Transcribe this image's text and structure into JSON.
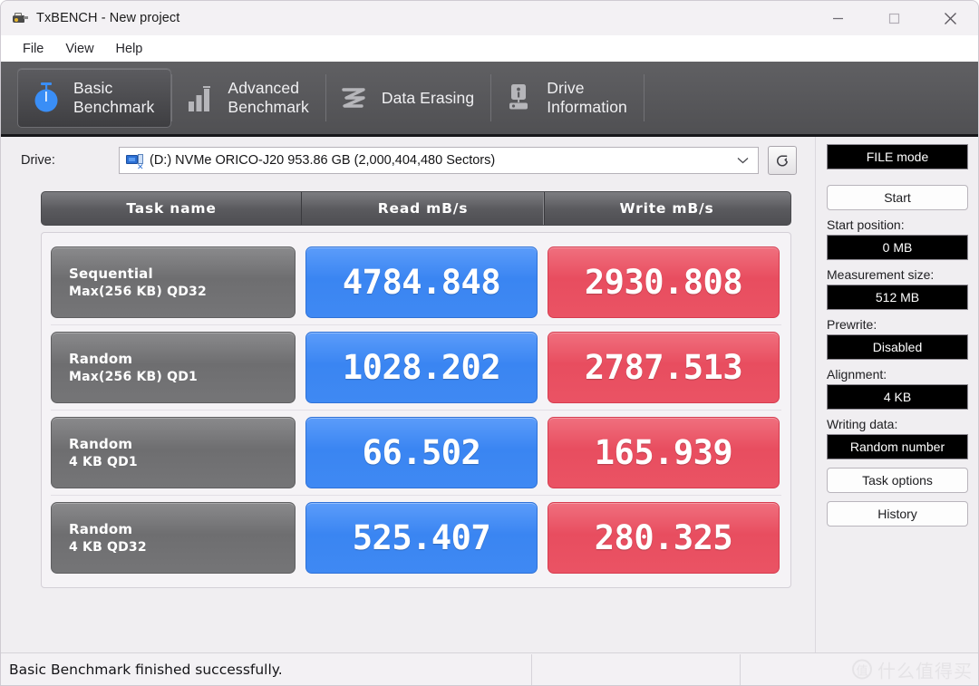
{
  "window": {
    "title": "TxBENCH - New project",
    "icon": "app-icon",
    "controls": {
      "minimize": "minimize-icon",
      "maximize": "maximize-icon",
      "close": "close-icon"
    }
  },
  "menubar": {
    "items": [
      {
        "label": "File"
      },
      {
        "label": "View"
      },
      {
        "label": "Help"
      }
    ]
  },
  "tabs": [
    {
      "label": "Basic\nBenchmark",
      "icon": "stopwatch-icon",
      "active": true
    },
    {
      "label": "Advanced\nBenchmark",
      "icon": "bar-chart-icon",
      "active": false
    },
    {
      "label": "Data Erasing",
      "icon": "eraser-wave-icon",
      "active": false
    },
    {
      "label": "Drive\nInformation",
      "icon": "drive-info-icon",
      "active": false
    }
  ],
  "drive": {
    "label": "Drive:",
    "value": "(D:) NVMe ORICO-J20  953.86 GB (2,000,404,480 Sectors)",
    "icon": "network-drive-icon",
    "caret": "chevron-down-icon",
    "refresh": "refresh-icon"
  },
  "results": {
    "headers": [
      "Task name",
      "Read mB/s",
      "Write mB/s"
    ],
    "rows": [
      {
        "task_line1": "Sequential",
        "task_line2": "Max(256 KB) QD32",
        "read": "4784.848",
        "write": "2930.808"
      },
      {
        "task_line1": "Random",
        "task_line2": "Max(256 KB) QD1",
        "read": "1028.202",
        "write": "2787.513"
      },
      {
        "task_line1": "Random",
        "task_line2": "4 KB QD1",
        "read": "66.502",
        "write": "165.939"
      },
      {
        "task_line1": "Random",
        "task_line2": "4 KB QD32",
        "read": "525.407",
        "write": "280.325"
      }
    ]
  },
  "sidebar": {
    "mode_value": "FILE mode",
    "start_label": "Start",
    "start_position_label": "Start position:",
    "start_position_value": "0 MB",
    "measurement_size_label": "Measurement size:",
    "measurement_size_value": "512 MB",
    "prewrite_label": "Prewrite:",
    "prewrite_value": "Disabled",
    "alignment_label": "Alignment:",
    "alignment_value": "4 KB",
    "writing_data_label": "Writing data:",
    "writing_data_value": "Random number",
    "task_options_label": "Task options",
    "history_label": "History"
  },
  "statusbar": {
    "message": "Basic Benchmark finished successfully."
  },
  "watermark": {
    "badge": "值",
    "text": "什么值得买"
  },
  "colors": {
    "read_accent": "#3f89f3",
    "write_accent": "#ea5364",
    "tabstrip_bg": "#59595c",
    "task_cell": "#757577",
    "field_bg": "#000000"
  }
}
